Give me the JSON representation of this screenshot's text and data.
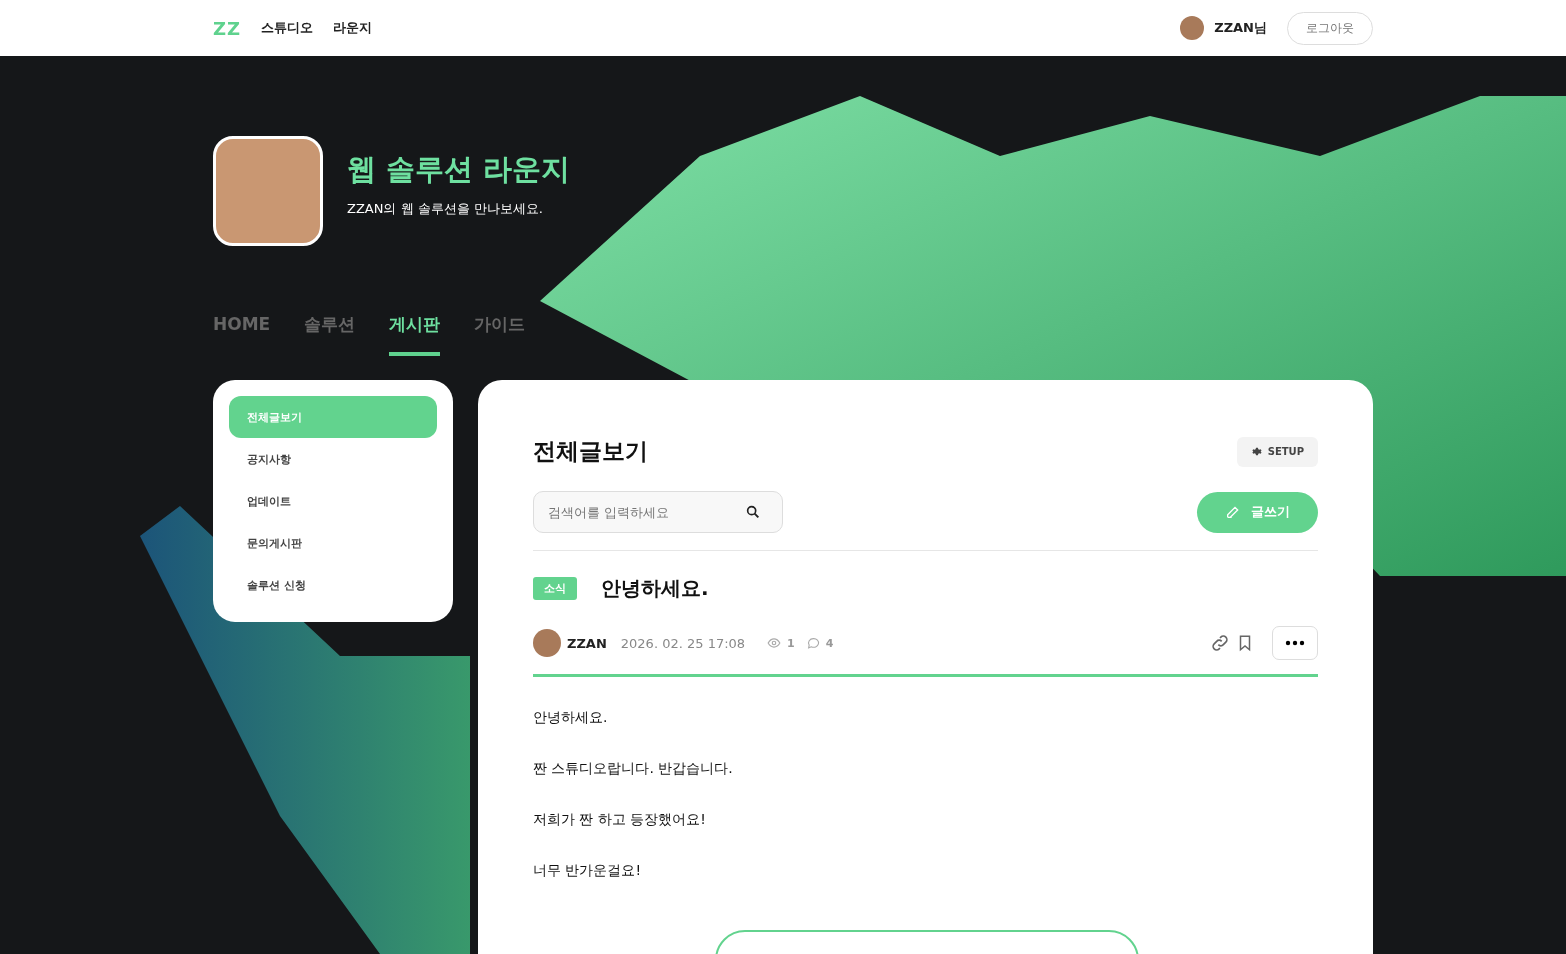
{
  "header": {
    "logo": "ZZ",
    "nav": [
      {
        "label": "스튜디오"
      },
      {
        "label": "라운지"
      }
    ],
    "user_name": "ZZAN님",
    "logout": "로그아웃"
  },
  "hero": {
    "title": "웹 솔루션 라운지",
    "subtitle": "ZZAN의 웹 솔루션을 만나보세요."
  },
  "tabs": [
    {
      "label": "HOME",
      "selected": false
    },
    {
      "label": "솔루션",
      "selected": false
    },
    {
      "label": "게시판",
      "selected": true
    },
    {
      "label": "가이드",
      "selected": false
    }
  ],
  "sidebar": {
    "items": [
      {
        "label": "전체글보기",
        "selected": true
      },
      {
        "label": "공지사항",
        "selected": false
      },
      {
        "label": "업데이트",
        "selected": false
      },
      {
        "label": "문의게시판",
        "selected": false
      },
      {
        "label": "솔루션 신청",
        "selected": false
      }
    ]
  },
  "board": {
    "title": "전체글보기",
    "setup": "SETUP",
    "search": {
      "placeholder": "검색어를 입력하세요"
    },
    "write": "글쓰기"
  },
  "post": {
    "tag": "소식",
    "title": "안녕하세요.",
    "author": "ZZAN",
    "date": "2026. 02. 25 17:08",
    "views": "1",
    "comments": "4",
    "body": [
      "안녕하세요.",
      "짠 스튜디오랍니다. 반갑습니다.",
      "저희가 짠 하고 등장했어요!",
      "너무 반가운걸요!"
    ]
  }
}
